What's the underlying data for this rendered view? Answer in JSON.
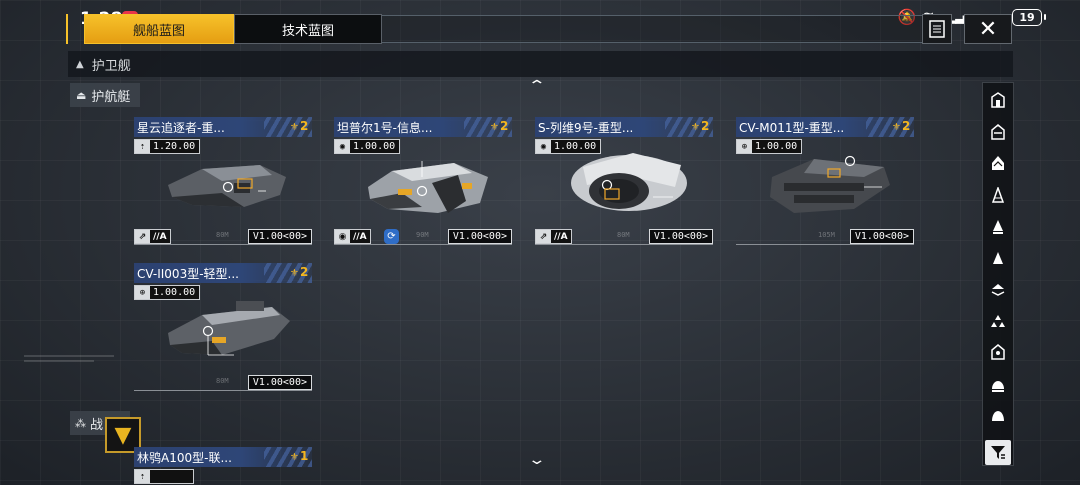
{
  "status": {
    "time": "1:28",
    "battery": "19"
  },
  "tabs": [
    {
      "label": "舰船蓝图",
      "active": true
    },
    {
      "label": "技术蓝图",
      "active": false
    }
  ],
  "section": {
    "label": "护卫舰"
  },
  "subsection": {
    "label": "护航艇"
  },
  "ships": [
    {
      "name": "星云追逐者-重...",
      "rank": "2",
      "version": "1.20.00",
      "class_icon": "flame-icon",
      "tag": "//A",
      "model": "V1.00<00>"
    },
    {
      "name": "坦普尔1号-信息...",
      "rank": "2",
      "version": "1.00.00",
      "class_icon": "signal-icon",
      "tag": "//A",
      "model": "V1.00<00>",
      "extra_tag": true
    },
    {
      "name": "S-列维9号-重型...",
      "rank": "2",
      "version": "1.00.00",
      "class_icon": "signal-icon",
      "tag": "//A",
      "model": "V1.00<00>"
    },
    {
      "name": "CV-M011型-重型...",
      "rank": "2",
      "version": "1.00.00",
      "class_icon": "globe-icon",
      "tag": "",
      "model": "V1.00<00>"
    },
    {
      "name": "CV-II003型-轻型...",
      "rank": "2",
      "version": "1.00.00",
      "class_icon": "globe-icon",
      "tag": "",
      "model": "V1.00<00>"
    }
  ],
  "next_section": {
    "label": "战",
    "ship_name": "林鸮A100型-联...",
    "rank": "1"
  },
  "sidebar": {
    "icons": [
      "hangar-icon",
      "carrier-icon",
      "cruiser-icon",
      "destroyer-icon",
      "frigate-icon",
      "corvette-icon",
      "escort-icon",
      "fighter-icon",
      "station-icon",
      "dome-icon",
      "bell-icon"
    ]
  },
  "colors": {
    "accent": "#f6c12a",
    "title_blue": "#2e4677",
    "rank_gold": "#f3b61f"
  }
}
